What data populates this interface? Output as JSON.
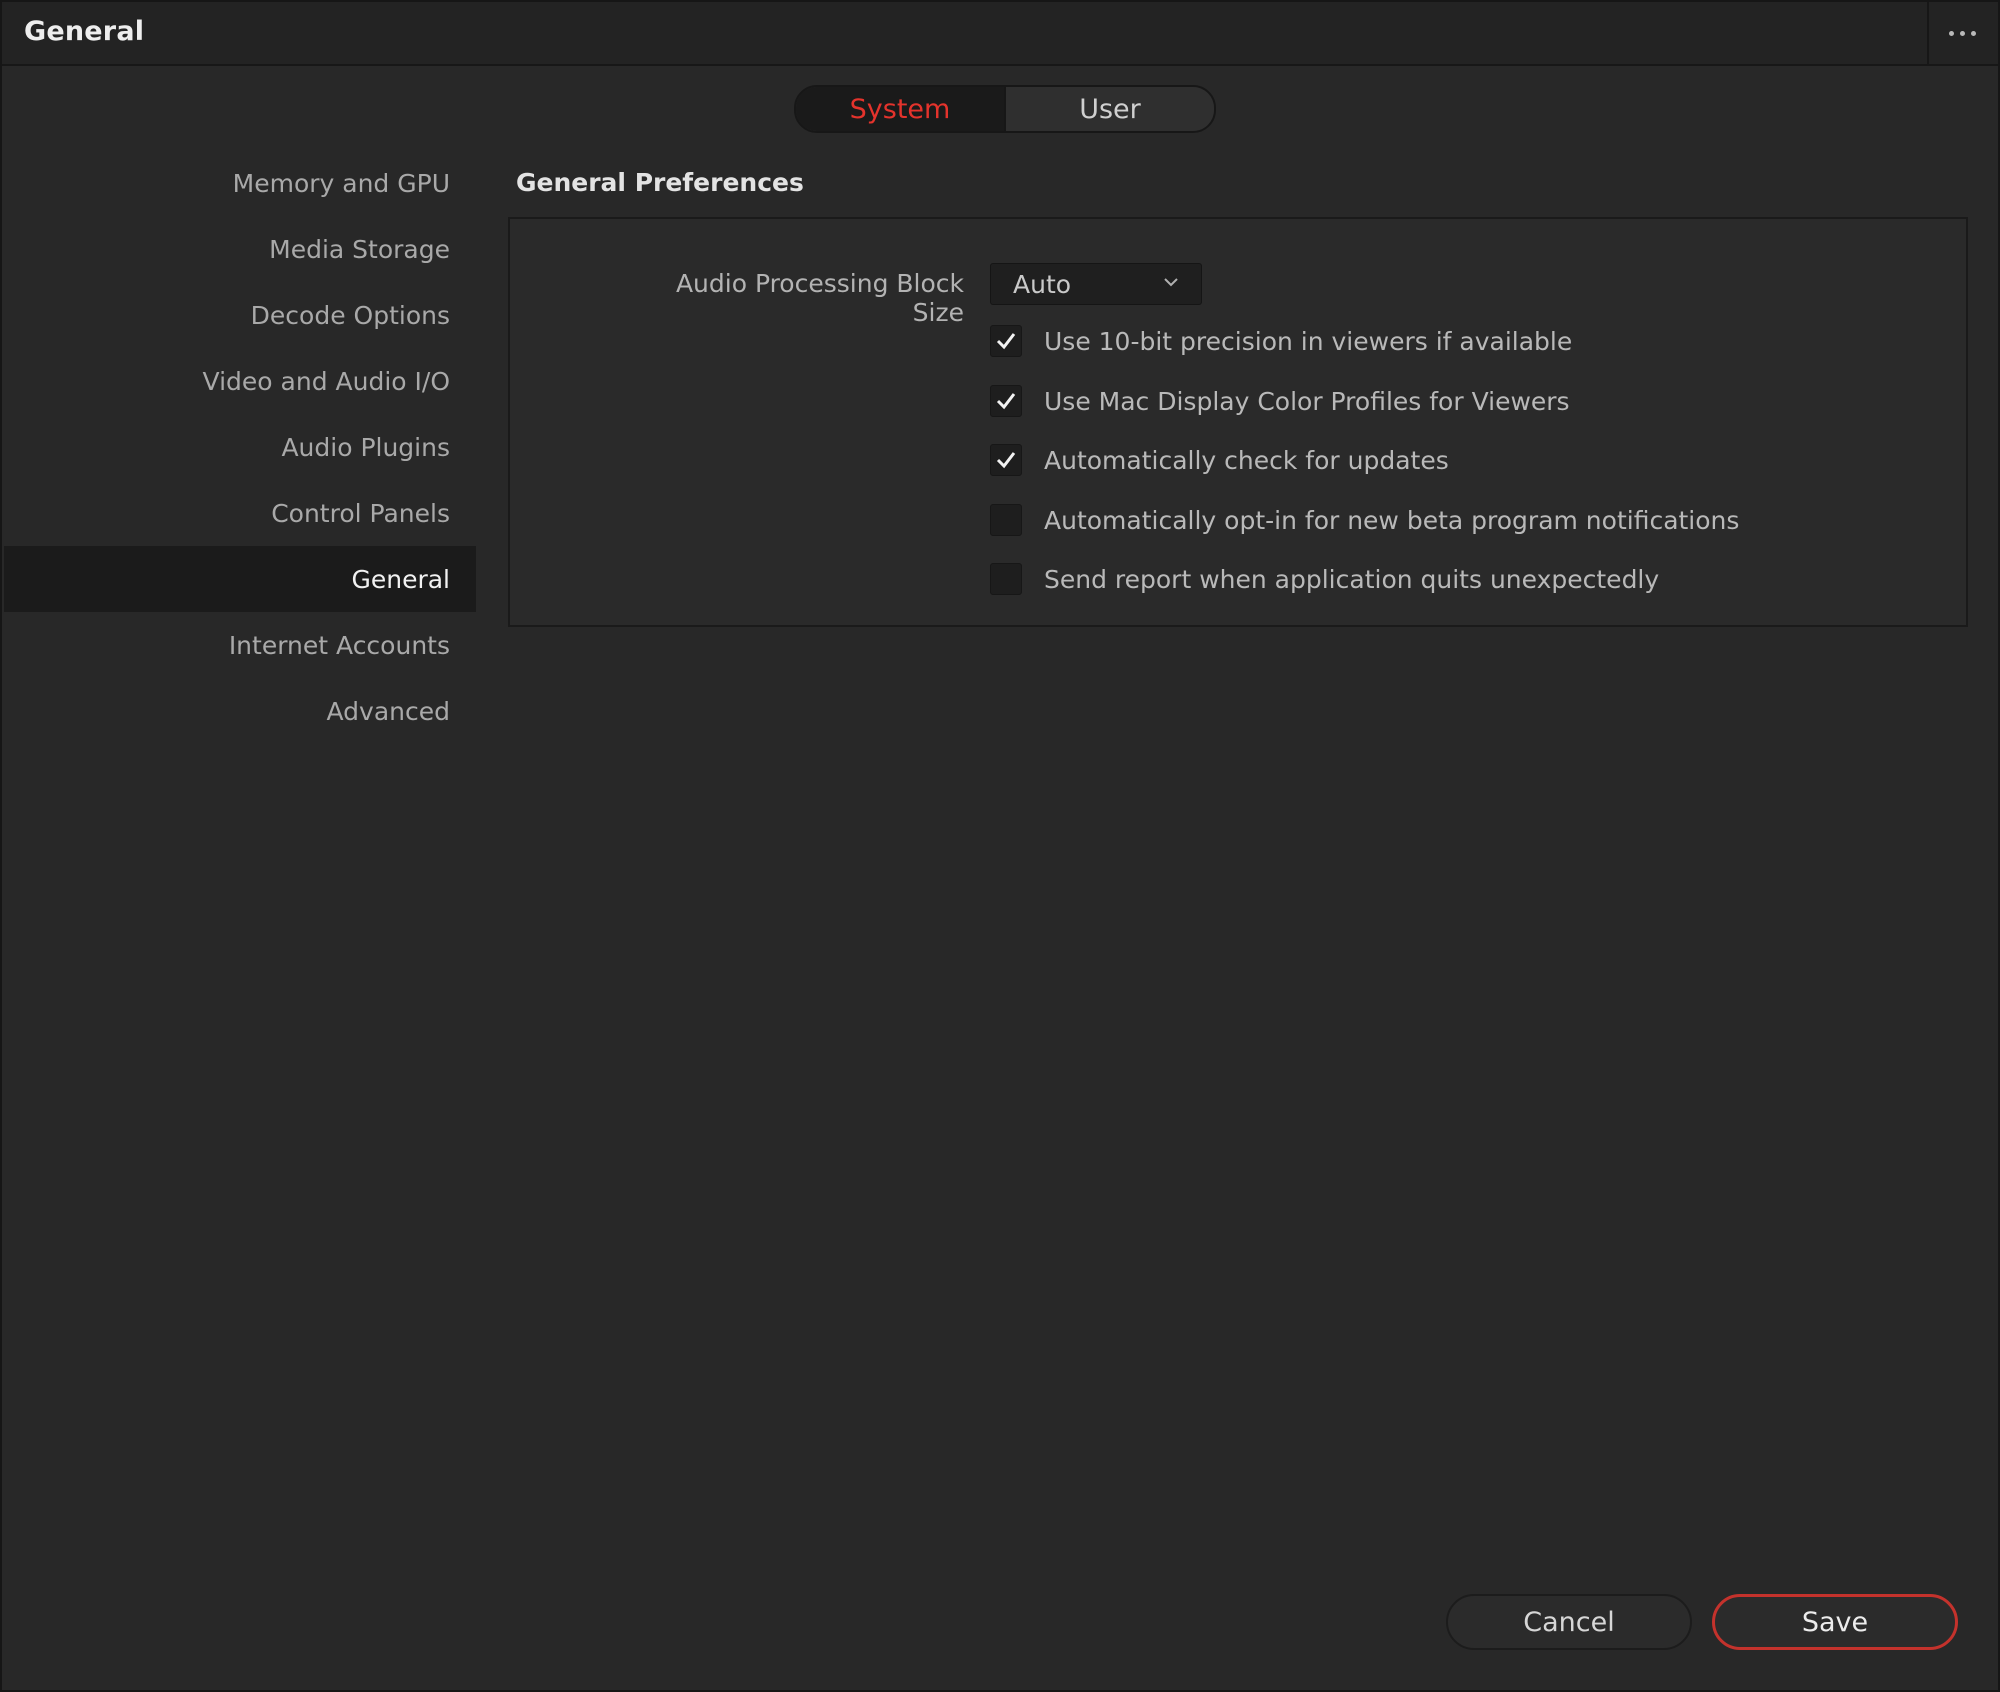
{
  "window": {
    "title": "General"
  },
  "tabs": [
    {
      "label": "System",
      "active": true
    },
    {
      "label": "User",
      "active": false
    }
  ],
  "sidebar": {
    "items": [
      {
        "label": "Memory and GPU"
      },
      {
        "label": "Media Storage"
      },
      {
        "label": "Decode Options"
      },
      {
        "label": "Video and Audio I/O"
      },
      {
        "label": "Audio Plugins"
      },
      {
        "label": "Control Panels"
      },
      {
        "label": "General",
        "selected": true
      },
      {
        "label": "Internet Accounts"
      },
      {
        "label": "Advanced"
      }
    ]
  },
  "main": {
    "section_title": "General Preferences",
    "audio_block_size": {
      "label": "Audio Processing Block Size",
      "value": "Auto"
    },
    "options": [
      {
        "label": "Use 10-bit precision in viewers if available",
        "checked": true
      },
      {
        "label": "Use Mac Display Color Profiles for Viewers",
        "checked": true
      },
      {
        "label": "Automatically check for updates",
        "checked": true
      },
      {
        "label": "Automatically opt-in for new beta program notifications",
        "checked": false
      },
      {
        "label": "Send report when application quits unexpectedly",
        "checked": false
      }
    ]
  },
  "footer": {
    "cancel_label": "Cancel",
    "save_label": "Save"
  },
  "colors": {
    "accent": "#e4332c",
    "background": "#282828"
  },
  "icons": {
    "more": "more-horizontal-icon",
    "dropdown": "chevron-down-icon",
    "check": "checkmark-icon"
  }
}
